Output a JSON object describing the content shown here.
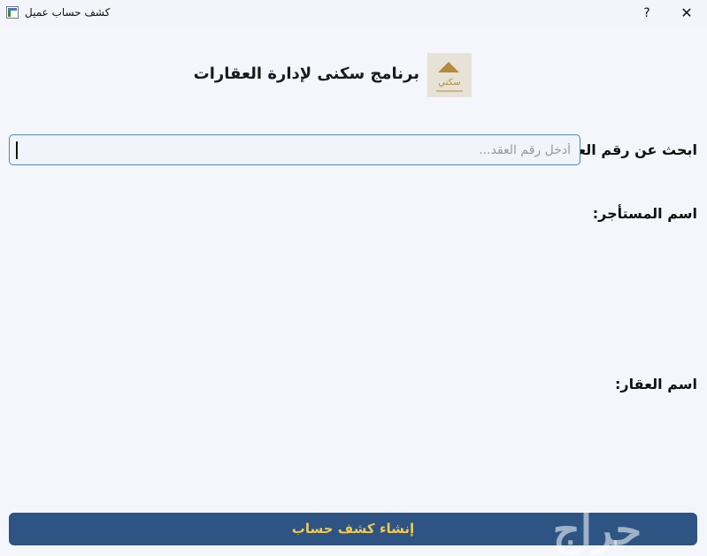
{
  "window": {
    "title": "كشف حساب عميل",
    "help_label": "?",
    "close_label": "✕"
  },
  "header": {
    "logo_text": "سكني",
    "app_title": "برنامج سكنى لإدارة العقارات"
  },
  "search": {
    "label": "ابحث عن رقم العقد:",
    "placeholder": "أدخل رقم العقد...",
    "value": ""
  },
  "details": {
    "tenant_label": "اسم المستأجر:",
    "property_label": "اسم العقار:"
  },
  "actions": {
    "create_statement_label": "إنشاء كشف حساب"
  },
  "watermark": "حراج",
  "colors": {
    "button_bg": "#2d5483",
    "button_text": "#f2c94c",
    "input_border": "#4e86b7",
    "background": "#f4f6fb"
  }
}
